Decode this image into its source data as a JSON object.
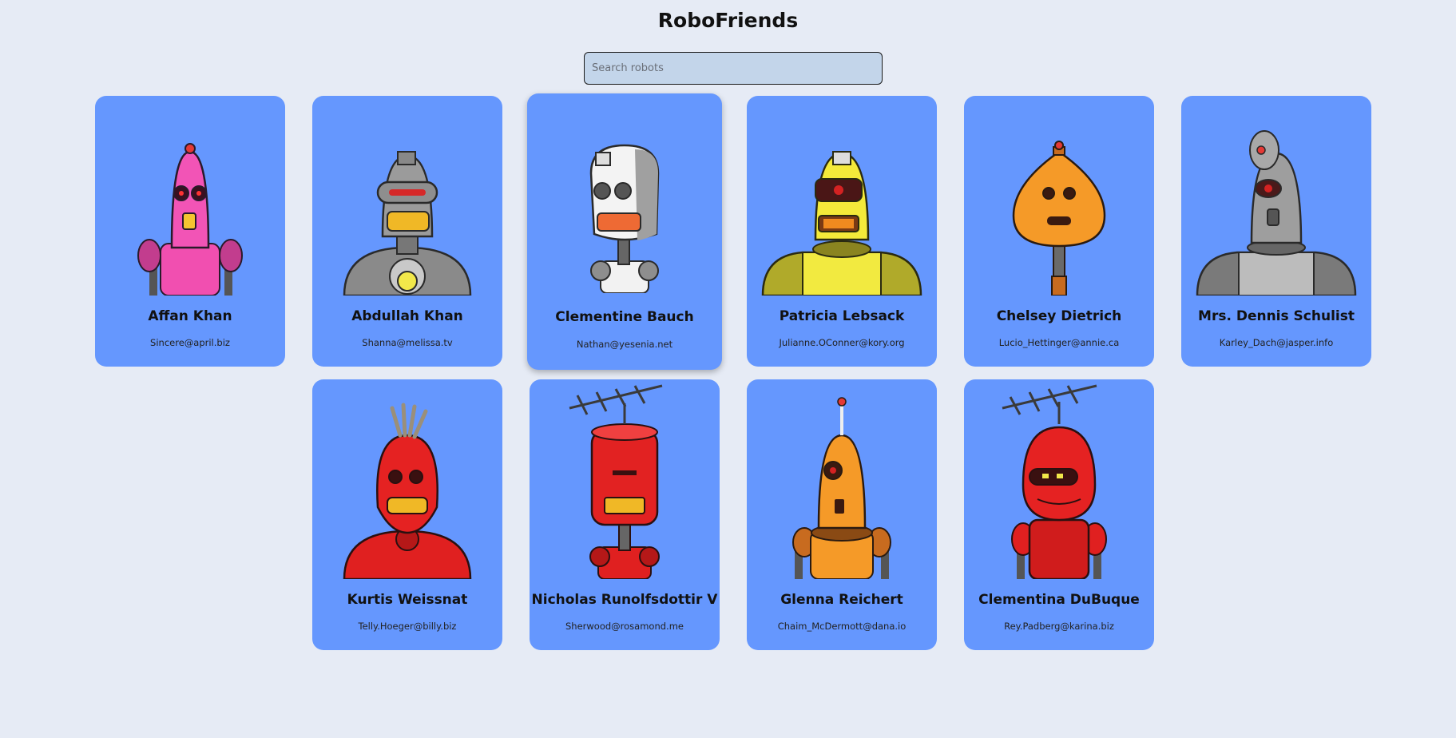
{
  "header": {
    "title": "RoboFriends"
  },
  "search": {
    "placeholder": "Search robots",
    "value": ""
  },
  "robots": [
    {
      "name": "Affan Khan",
      "email": "Sincere@april.biz",
      "icon": "pink-robot-icon"
    },
    {
      "name": "Abdullah Khan",
      "email": "Shanna@melissa.tv",
      "icon": "gray-robot-visor-icon"
    },
    {
      "name": "Clementine Bauch",
      "email": "Nathan@yesenia.net",
      "icon": "white-robot-icon"
    },
    {
      "name": "Patricia Lebsack",
      "email": "Julianne.OConner@kory.org",
      "icon": "yellow-robot-icon"
    },
    {
      "name": "Chelsey Dietrich",
      "email": "Lucio_Hettinger@annie.ca",
      "icon": "orange-robot-icon"
    },
    {
      "name": "Mrs. Dennis Schulist",
      "email": "Karley_Dach@jasper.info",
      "icon": "gray-robot-dish-icon"
    },
    {
      "name": "Kurtis Weissnat",
      "email": "Telly.Hoeger@billy.biz",
      "icon": "red-robot-icon"
    },
    {
      "name": "Nicholas Runolfsdottir V",
      "email": "Sherwood@rosamond.me",
      "icon": "red-robot-antenna-icon"
    },
    {
      "name": "Glenna Reichert",
      "email": "Chaim_McDermott@dana.io",
      "icon": "orange-robot-cyclops-icon"
    },
    {
      "name": "Clementina DuBuque",
      "email": "Rey.Padberg@karina.biz",
      "icon": "red-robot-helmet-icon"
    }
  ],
  "colors": {
    "background": "#e6ebf5",
    "card": "#6597fe",
    "search": "#c3d5ea"
  }
}
